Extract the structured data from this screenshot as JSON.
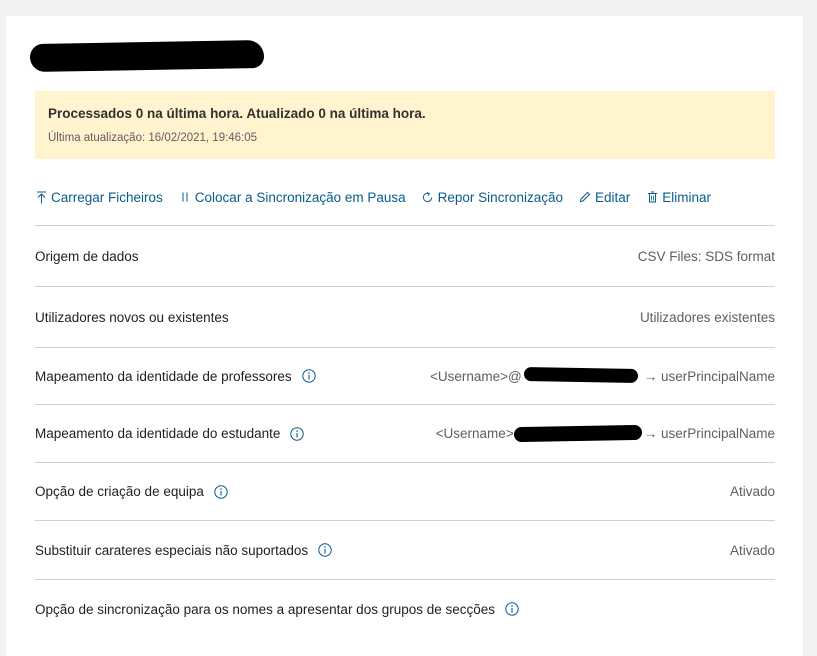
{
  "banner": {
    "message": "Processados 0 na última hora. Atualizado 0 na última hora.",
    "last_update": "Última atualização: 16/02/2021, 19:46:05",
    "color": "#fff4ce"
  },
  "toolbar": {
    "upload": {
      "label": "Carregar Ficheiros",
      "icon": "upload-icon"
    },
    "pause": {
      "label": "Colocar a Sincronização em Pausa",
      "icon": "pause-icon"
    },
    "reset": {
      "label": "Repor Sincronização",
      "icon": "refresh-icon"
    },
    "edit": {
      "label": "Editar",
      "icon": "pencil-icon"
    },
    "delete": {
      "label": "Eliminar",
      "icon": "trash-icon"
    },
    "link_color": "#0a5b8c"
  },
  "rows": [
    {
      "label": "Origem de dados",
      "value": "CSV Files: SDS format"
    },
    {
      "label": "Utilizadores novos ou existentes",
      "value": "Utilizadores existentes"
    },
    {
      "label": "Mapeamento da identidade de professores",
      "value_prefix": "<Username>@",
      "value_suffix": "→ userPrincipalName"
    },
    {
      "label": "Mapeamento da identidade do estudante",
      "value_prefix": "<Username>",
      "value_suffix": "→ userPrincipalName"
    },
    {
      "label": "Opção de criação de equipa",
      "value": "Ativado"
    },
    {
      "label": "Substituir carateres especiais não suportados",
      "value": "Ativado"
    },
    {
      "label": "Opção de sincronização para os nomes a apresentar dos grupos de secções",
      "value": ""
    }
  ]
}
